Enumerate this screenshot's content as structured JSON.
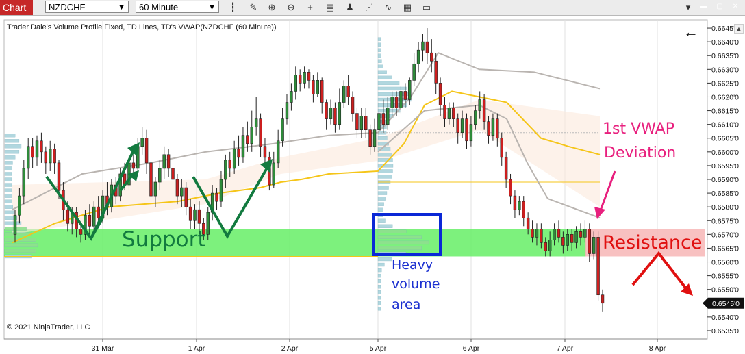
{
  "toolbar": {
    "tab_label": "Chart",
    "instrument": "NZDCHF",
    "interval": "60 Minute",
    "icons": [
      "bars-icon",
      "pencil-icon",
      "zoom-in-icon",
      "zoom-out-icon",
      "crosshair-icon",
      "properties-icon",
      "strategy-icon",
      "drawing-tools-icon",
      "data-box-icon"
    ],
    "window_buttons": [
      "minimize",
      "maximize",
      "close"
    ],
    "colors": {
      "tab": "#c62828",
      "window_minimize": "#c62828",
      "window_maximize": "#c62828",
      "window_close": "#c62828"
    }
  },
  "chart_title": "Trader Dale's Volume Profile Fixed, TD Lines, TD's VWAP(NZDCHF (60 Minute))",
  "copyright": "© 2021 NinjaTrader, LLC",
  "back_arrow": "←",
  "chart_data": {
    "type": "candlestick",
    "title": "Trader Dale's Volume Profile Fixed, TD Lines, TD's VWAP(NZDCHF (60 Minute))",
    "ylim": [
      0.6532,
      0.6648
    ],
    "y_ticks": [
      "0.6645'0",
      "0.6640'0",
      "0.6635'0",
      "0.6630'0",
      "0.6625'0",
      "0.6620'0",
      "0.6615'0",
      "0.6610'0",
      "0.6605'0",
      "0.6600'0",
      "0.6595'0",
      "0.6590'0",
      "0.6585'0",
      "0.6580'0",
      "0.6575'0",
      "0.6570'0",
      "0.6565'0",
      "0.6560'0",
      "0.6555'0",
      "0.6550'0",
      "0.6545'0",
      "0.6540'0",
      "0.6535'0"
    ],
    "y_tick_values": [
      0.6645,
      0.664,
      0.6635,
      0.663,
      0.6625,
      0.662,
      0.6615,
      0.661,
      0.6605,
      0.66,
      0.6595,
      0.659,
      0.6585,
      0.658,
      0.6575,
      0.657,
      0.6565,
      0.656,
      0.6555,
      0.655,
      0.6545,
      0.654,
      0.6535
    ],
    "x_labels": [
      "31 Mar",
      "1 Apr",
      "2 Apr",
      "5 Apr",
      "6 Apr",
      "7 Apr",
      "8 Apr"
    ],
    "last_price": "0.6545'0",
    "grid": true,
    "colors": {
      "up": "#2e8b3a",
      "down": "#cc1f1f",
      "vwap": "#f5c518",
      "deviation": "#b9b4b0",
      "support_zone": "#66ee66",
      "resistance_zone": "#f7b6b6",
      "profile": "#a9d3dc",
      "profile_poc": "#8fe08f",
      "box": "#0a28d6",
      "annot_green": "#127a3f",
      "annot_red": "#e01010",
      "annot_pink": "#e8207e",
      "annot_blue": "#1a2fd0"
    },
    "annotations": {
      "support": "Support",
      "resistance": "Resistance",
      "vwap_label_line1": "1st VWAP",
      "vwap_label_line2": "Deviation",
      "heavy_line1": "Heavy",
      "heavy_line2": "volume",
      "heavy_line3": "area"
    },
    "candles": [
      [
        0.657,
        0.6577,
        0.6567,
        0.6579
      ],
      [
        0.6577,
        0.6584,
        0.6574,
        0.6587
      ],
      [
        0.6584,
        0.6594,
        0.6581,
        0.6597
      ],
      [
        0.6594,
        0.6602,
        0.659,
        0.6605
      ],
      [
        0.6602,
        0.6598,
        0.6594,
        0.6605
      ],
      [
        0.6598,
        0.6604,
        0.6595,
        0.6606
      ],
      [
        0.6604,
        0.66,
        0.6596,
        0.6607
      ],
      [
        0.66,
        0.6596,
        0.6592,
        0.6602
      ],
      [
        0.6596,
        0.6601,
        0.6593,
        0.6604
      ],
      [
        0.6601,
        0.6596,
        0.6592,
        0.6603
      ],
      [
        0.6596,
        0.6586,
        0.6583,
        0.6597
      ],
      [
        0.6586,
        0.6579,
        0.6575,
        0.6589
      ],
      [
        0.6579,
        0.6574,
        0.6571,
        0.6582
      ],
      [
        0.6574,
        0.6578,
        0.657,
        0.658
      ],
      [
        0.6578,
        0.6572,
        0.6569,
        0.658
      ],
      [
        0.6572,
        0.657,
        0.6567,
        0.6574
      ],
      [
        0.657,
        0.6577,
        0.6568,
        0.6579
      ],
      [
        0.6577,
        0.6573,
        0.657,
        0.6581
      ],
      [
        0.6573,
        0.658,
        0.6571,
        0.6582
      ],
      [
        0.658,
        0.6576,
        0.6574,
        0.6584
      ],
      [
        0.6576,
        0.6584,
        0.6574,
        0.6586
      ],
      [
        0.6584,
        0.658,
        0.6577,
        0.6589
      ],
      [
        0.658,
        0.6588,
        0.6578,
        0.659
      ],
      [
        0.6588,
        0.6584,
        0.6581,
        0.6591
      ],
      [
        0.6584,
        0.6592,
        0.6582,
        0.6594
      ],
      [
        0.6592,
        0.6588,
        0.6586,
        0.6596
      ],
      [
        0.6588,
        0.6596,
        0.6586,
        0.6599
      ],
      [
        0.6596,
        0.6594,
        0.6591,
        0.6599
      ],
      [
        0.6594,
        0.6602,
        0.6592,
        0.6605
      ],
      [
        0.6602,
        0.6605,
        0.6599,
        0.6609
      ],
      [
        0.6605,
        0.6596,
        0.6592,
        0.6608
      ],
      [
        0.6596,
        0.6584,
        0.6581,
        0.6597
      ],
      [
        0.6584,
        0.6589,
        0.658,
        0.6591
      ],
      [
        0.6589,
        0.6594,
        0.6586,
        0.6597
      ],
      [
        0.6594,
        0.6599,
        0.659,
        0.6602
      ],
      [
        0.6599,
        0.6594,
        0.6591,
        0.6601
      ],
      [
        0.6594,
        0.659,
        0.6588,
        0.6597
      ],
      [
        0.659,
        0.6584,
        0.6581,
        0.6592
      ],
      [
        0.6584,
        0.6587,
        0.658,
        0.659
      ],
      [
        0.6587,
        0.658,
        0.6577,
        0.6589
      ],
      [
        0.658,
        0.6575,
        0.6572,
        0.6583
      ],
      [
        0.6575,
        0.6579,
        0.6572,
        0.6581
      ],
      [
        0.6579,
        0.6574,
        0.657,
        0.6582
      ],
      [
        0.6574,
        0.657,
        0.6568,
        0.6576
      ],
      [
        0.657,
        0.6578,
        0.6568,
        0.658
      ],
      [
        0.6578,
        0.6585,
        0.6575,
        0.6588
      ],
      [
        0.6585,
        0.6582,
        0.6579,
        0.6587
      ],
      [
        0.6582,
        0.659,
        0.658,
        0.6593
      ],
      [
        0.659,
        0.6597,
        0.6587,
        0.6599
      ],
      [
        0.6597,
        0.6594,
        0.6591,
        0.66
      ],
      [
        0.6594,
        0.6601,
        0.6592,
        0.6604
      ],
      [
        0.6601,
        0.6598,
        0.6595,
        0.6606
      ],
      [
        0.6598,
        0.6606,
        0.6596,
        0.6609
      ],
      [
        0.6606,
        0.6603,
        0.66,
        0.6611
      ],
      [
        0.6603,
        0.6609,
        0.66,
        0.6615
      ],
      [
        0.6609,
        0.6612,
        0.6606,
        0.662
      ],
      [
        0.6612,
        0.6602,
        0.6598,
        0.6614
      ],
      [
        0.6602,
        0.6598,
        0.6595,
        0.6605
      ],
      [
        0.6598,
        0.6588,
        0.6586,
        0.66
      ],
      [
        0.6588,
        0.6596,
        0.6587,
        0.66
      ],
      [
        0.6596,
        0.6604,
        0.6594,
        0.6608
      ],
      [
        0.6604,
        0.6612,
        0.6602,
        0.6616
      ],
      [
        0.6612,
        0.6618,
        0.661,
        0.6621
      ],
      [
        0.6618,
        0.6622,
        0.6615,
        0.6625
      ],
      [
        0.6622,
        0.6628,
        0.6619,
        0.6631
      ],
      [
        0.6628,
        0.6625,
        0.6622,
        0.663
      ],
      [
        0.6625,
        0.6629,
        0.6623,
        0.6631
      ],
      [
        0.6629,
        0.6626,
        0.6623,
        0.663
      ],
      [
        0.6626,
        0.6621,
        0.6618,
        0.6628
      ],
      [
        0.6621,
        0.6626,
        0.662,
        0.6629
      ],
      [
        0.6626,
        0.6618,
        0.6614,
        0.6627
      ],
      [
        0.6618,
        0.6612,
        0.6608,
        0.6619
      ],
      [
        0.6612,
        0.6616,
        0.661,
        0.6619
      ],
      [
        0.6616,
        0.661,
        0.6607,
        0.6618
      ],
      [
        0.661,
        0.6618,
        0.6608,
        0.6623
      ],
      [
        0.6618,
        0.6624,
        0.6616,
        0.6626
      ],
      [
        0.6624,
        0.662,
        0.6617,
        0.6628
      ],
      [
        0.662,
        0.6614,
        0.6611,
        0.6622
      ],
      [
        0.6614,
        0.6608,
        0.6605,
        0.6616
      ],
      [
        0.6608,
        0.6613,
        0.6605,
        0.6616
      ],
      [
        0.6613,
        0.6608,
        0.6605,
        0.6616
      ],
      [
        0.6608,
        0.6602,
        0.6599,
        0.661
      ],
      [
        0.6602,
        0.6608,
        0.66,
        0.6612
      ],
      [
        0.6608,
        0.6614,
        0.6606,
        0.6618
      ],
      [
        0.6614,
        0.661,
        0.6607,
        0.6619
      ],
      [
        0.661,
        0.6616,
        0.6608,
        0.662
      ],
      [
        0.6616,
        0.662,
        0.6613,
        0.6622
      ],
      [
        0.662,
        0.6616,
        0.6613,
        0.6622
      ],
      [
        0.6616,
        0.6622,
        0.6614,
        0.6624
      ],
      [
        0.6622,
        0.6619,
        0.6616,
        0.6625
      ],
      [
        0.6619,
        0.6626,
        0.6617,
        0.6627
      ],
      [
        0.6626,
        0.6632,
        0.6624,
        0.6636
      ],
      [
        0.6632,
        0.6637,
        0.6629,
        0.664
      ],
      [
        0.6637,
        0.664,
        0.6633,
        0.6643
      ],
      [
        0.664,
        0.6636,
        0.6632,
        0.6645
      ],
      [
        0.6636,
        0.6633,
        0.6629,
        0.6641
      ],
      [
        0.6633,
        0.6625,
        0.6621,
        0.6636
      ],
      [
        0.6625,
        0.6617,
        0.6613,
        0.6627
      ],
      [
        0.6617,
        0.6612,
        0.6609,
        0.662
      ],
      [
        0.6612,
        0.6616,
        0.661,
        0.6618
      ],
      [
        0.6616,
        0.6612,
        0.6609,
        0.6618
      ],
      [
        0.6612,
        0.6607,
        0.6603,
        0.6614
      ],
      [
        0.6607,
        0.6612,
        0.6605,
        0.6615
      ],
      [
        0.6612,
        0.6604,
        0.6601,
        0.6614
      ],
      [
        0.6604,
        0.661,
        0.6602,
        0.6613
      ],
      [
        0.661,
        0.6615,
        0.6608,
        0.6617
      ],
      [
        0.6615,
        0.6619,
        0.6612,
        0.6622
      ],
      [
        0.6619,
        0.6611,
        0.6608,
        0.6621
      ],
      [
        0.6611,
        0.6606,
        0.6603,
        0.6613
      ],
      [
        0.6606,
        0.6612,
        0.6604,
        0.6614
      ],
      [
        0.6612,
        0.6605,
        0.6602,
        0.6614
      ],
      [
        0.6605,
        0.6598,
        0.6595,
        0.6607
      ],
      [
        0.6598,
        0.659,
        0.6587,
        0.66
      ],
      [
        0.659,
        0.6584,
        0.6581,
        0.6592
      ],
      [
        0.6584,
        0.6579,
        0.6576,
        0.6586
      ],
      [
        0.6579,
        0.6582,
        0.6577,
        0.6584
      ],
      [
        0.6582,
        0.6576,
        0.6573,
        0.6584
      ],
      [
        0.6576,
        0.6572,
        0.657,
        0.6578
      ],
      [
        0.6572,
        0.6569,
        0.6567,
        0.6575
      ],
      [
        0.6569,
        0.6572,
        0.6566,
        0.6574
      ],
      [
        0.6572,
        0.6567,
        0.6565,
        0.6574
      ],
      [
        0.6567,
        0.6564,
        0.6562,
        0.6569
      ],
      [
        0.6564,
        0.6568,
        0.6562,
        0.6571
      ],
      [
        0.6568,
        0.6572,
        0.6566,
        0.6574
      ],
      [
        0.6572,
        0.6569,
        0.6567,
        0.6575
      ],
      [
        0.6569,
        0.6566,
        0.6563,
        0.6571
      ],
      [
        0.6566,
        0.657,
        0.6564,
        0.6572
      ],
      [
        0.657,
        0.6567,
        0.6564,
        0.6572
      ],
      [
        0.6567,
        0.6571,
        0.6565,
        0.6573
      ],
      [
        0.6571,
        0.6569,
        0.6566,
        0.6574
      ],
      [
        0.6569,
        0.6572,
        0.6567,
        0.6575
      ],
      [
        0.6572,
        0.6563,
        0.656,
        0.6574
      ],
      [
        0.6563,
        0.6569,
        0.6561,
        0.6571
      ],
      [
        0.6569,
        0.6548,
        0.6546,
        0.6571
      ],
      [
        0.6548,
        0.6545,
        0.6542,
        0.655
      ]
    ]
  }
}
